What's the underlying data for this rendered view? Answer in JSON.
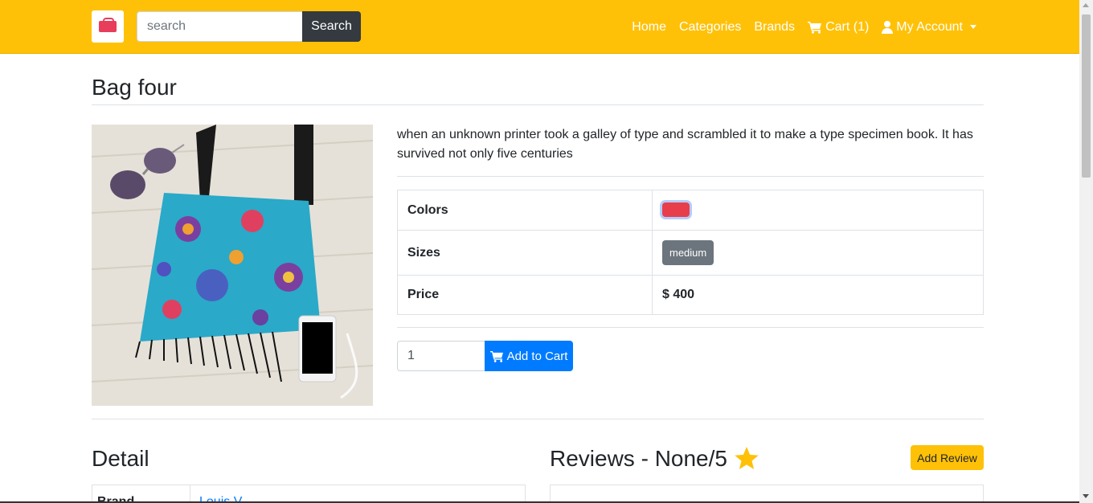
{
  "navbar": {
    "logo_text": "BAGS",
    "search_placeholder": "search",
    "search_button": "Search",
    "links": {
      "home": "Home",
      "categories": "Categories",
      "brands": "Brands",
      "cart": "Cart (1)",
      "account": "My Account"
    },
    "background_color": "#ffc107"
  },
  "product": {
    "title": "Bag four",
    "description": "when an unknown printer took a galley of type and scrambled it to make a type specimen book. It has survived not only five centuries",
    "specs": {
      "colors_label": "Colors",
      "color_value": "#e83e4c",
      "sizes_label": "Sizes",
      "size_value": "medium",
      "price_label": "Price",
      "price_value": "$ 400"
    },
    "quantity": "1",
    "add_to_cart": "Add to Cart"
  },
  "detail": {
    "title": "Detail",
    "first_row_label": "Brand",
    "first_row_value": "Louis V"
  },
  "reviews": {
    "title": "Reviews - None/5",
    "add_button": "Add Review"
  }
}
